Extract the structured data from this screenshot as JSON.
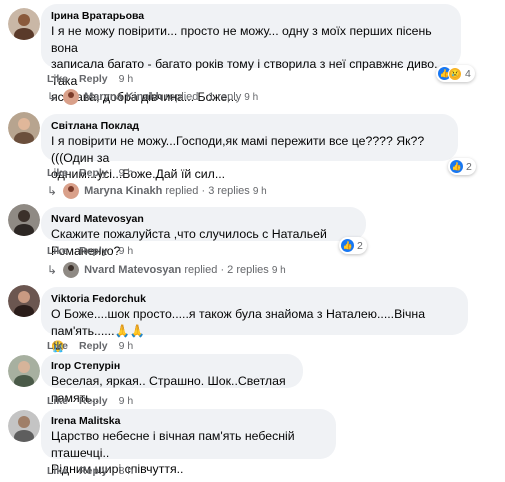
{
  "labels": {
    "like": "Like",
    "reply": "Reply",
    "replied": "replied",
    "dot": "·"
  },
  "comments": [
    {
      "author": "Ірина Вратарьова",
      "lines": [
        "І я не можу повірити... просто не можу... одну з моїх перших пісень вона",
        "записала багато - багато років тому і створила з неї справжнє диво. Така",
        "яскрава, добра дівчина... Боже..."
      ],
      "time": "9 h",
      "reactions": {
        "icons": [
          "like-icon",
          "sad-icon"
        ],
        "count": "4"
      },
      "replies": {
        "name": "Maryna Kinakh",
        "count_text": "1 reply",
        "time": "9 h"
      }
    },
    {
      "author": "Світлана Поклад",
      "lines": [
        "І я повірити не можу...Господи,як мамі пережити все це???? Як??(((Один за",
        "одним...усі...Боже.Дай їй сил..."
      ],
      "time": "9 h",
      "reactions": {
        "icons": [
          "like-icon"
        ],
        "count": "2"
      },
      "replies": {
        "name": "Maryna Kinakh",
        "count_text": "3 replies",
        "time": "9 h"
      }
    },
    {
      "author": "Nvard Matevosyan",
      "lines": [
        "Скажите пожалуйста ,что случилось с Натальей Романенко?"
      ],
      "time": "9 h",
      "reactions": {
        "icons": [
          "like-icon"
        ],
        "count": "2"
      },
      "replies": {
        "name": "Nvard Matevosyan",
        "count_text": "2 replies",
        "time": "9 h"
      }
    },
    {
      "author": "Viktoria Fedorchuk",
      "lines": [
        "О Боже....шок просто.....я також була знайома з Наталею.....Вічна пам'ять......🙏🙏",
        "😭"
      ],
      "time": "9 h"
    },
    {
      "author": "Ігор Степурін",
      "lines": [
        "Веселая, яркая.. Страшно. Шок..Светлая память.."
      ],
      "time": "9 h"
    },
    {
      "author": "Irena Malitska",
      "lines": [
        "Царство небесне і вічная пам'ять небесній пташечці..",
        "Рідним щирі співчуття.."
      ],
      "time": "8 h"
    }
  ],
  "colors": {
    "bubble": "#f0f2f5",
    "like_blue": "#1877f2",
    "meta_grey": "#65676b"
  }
}
